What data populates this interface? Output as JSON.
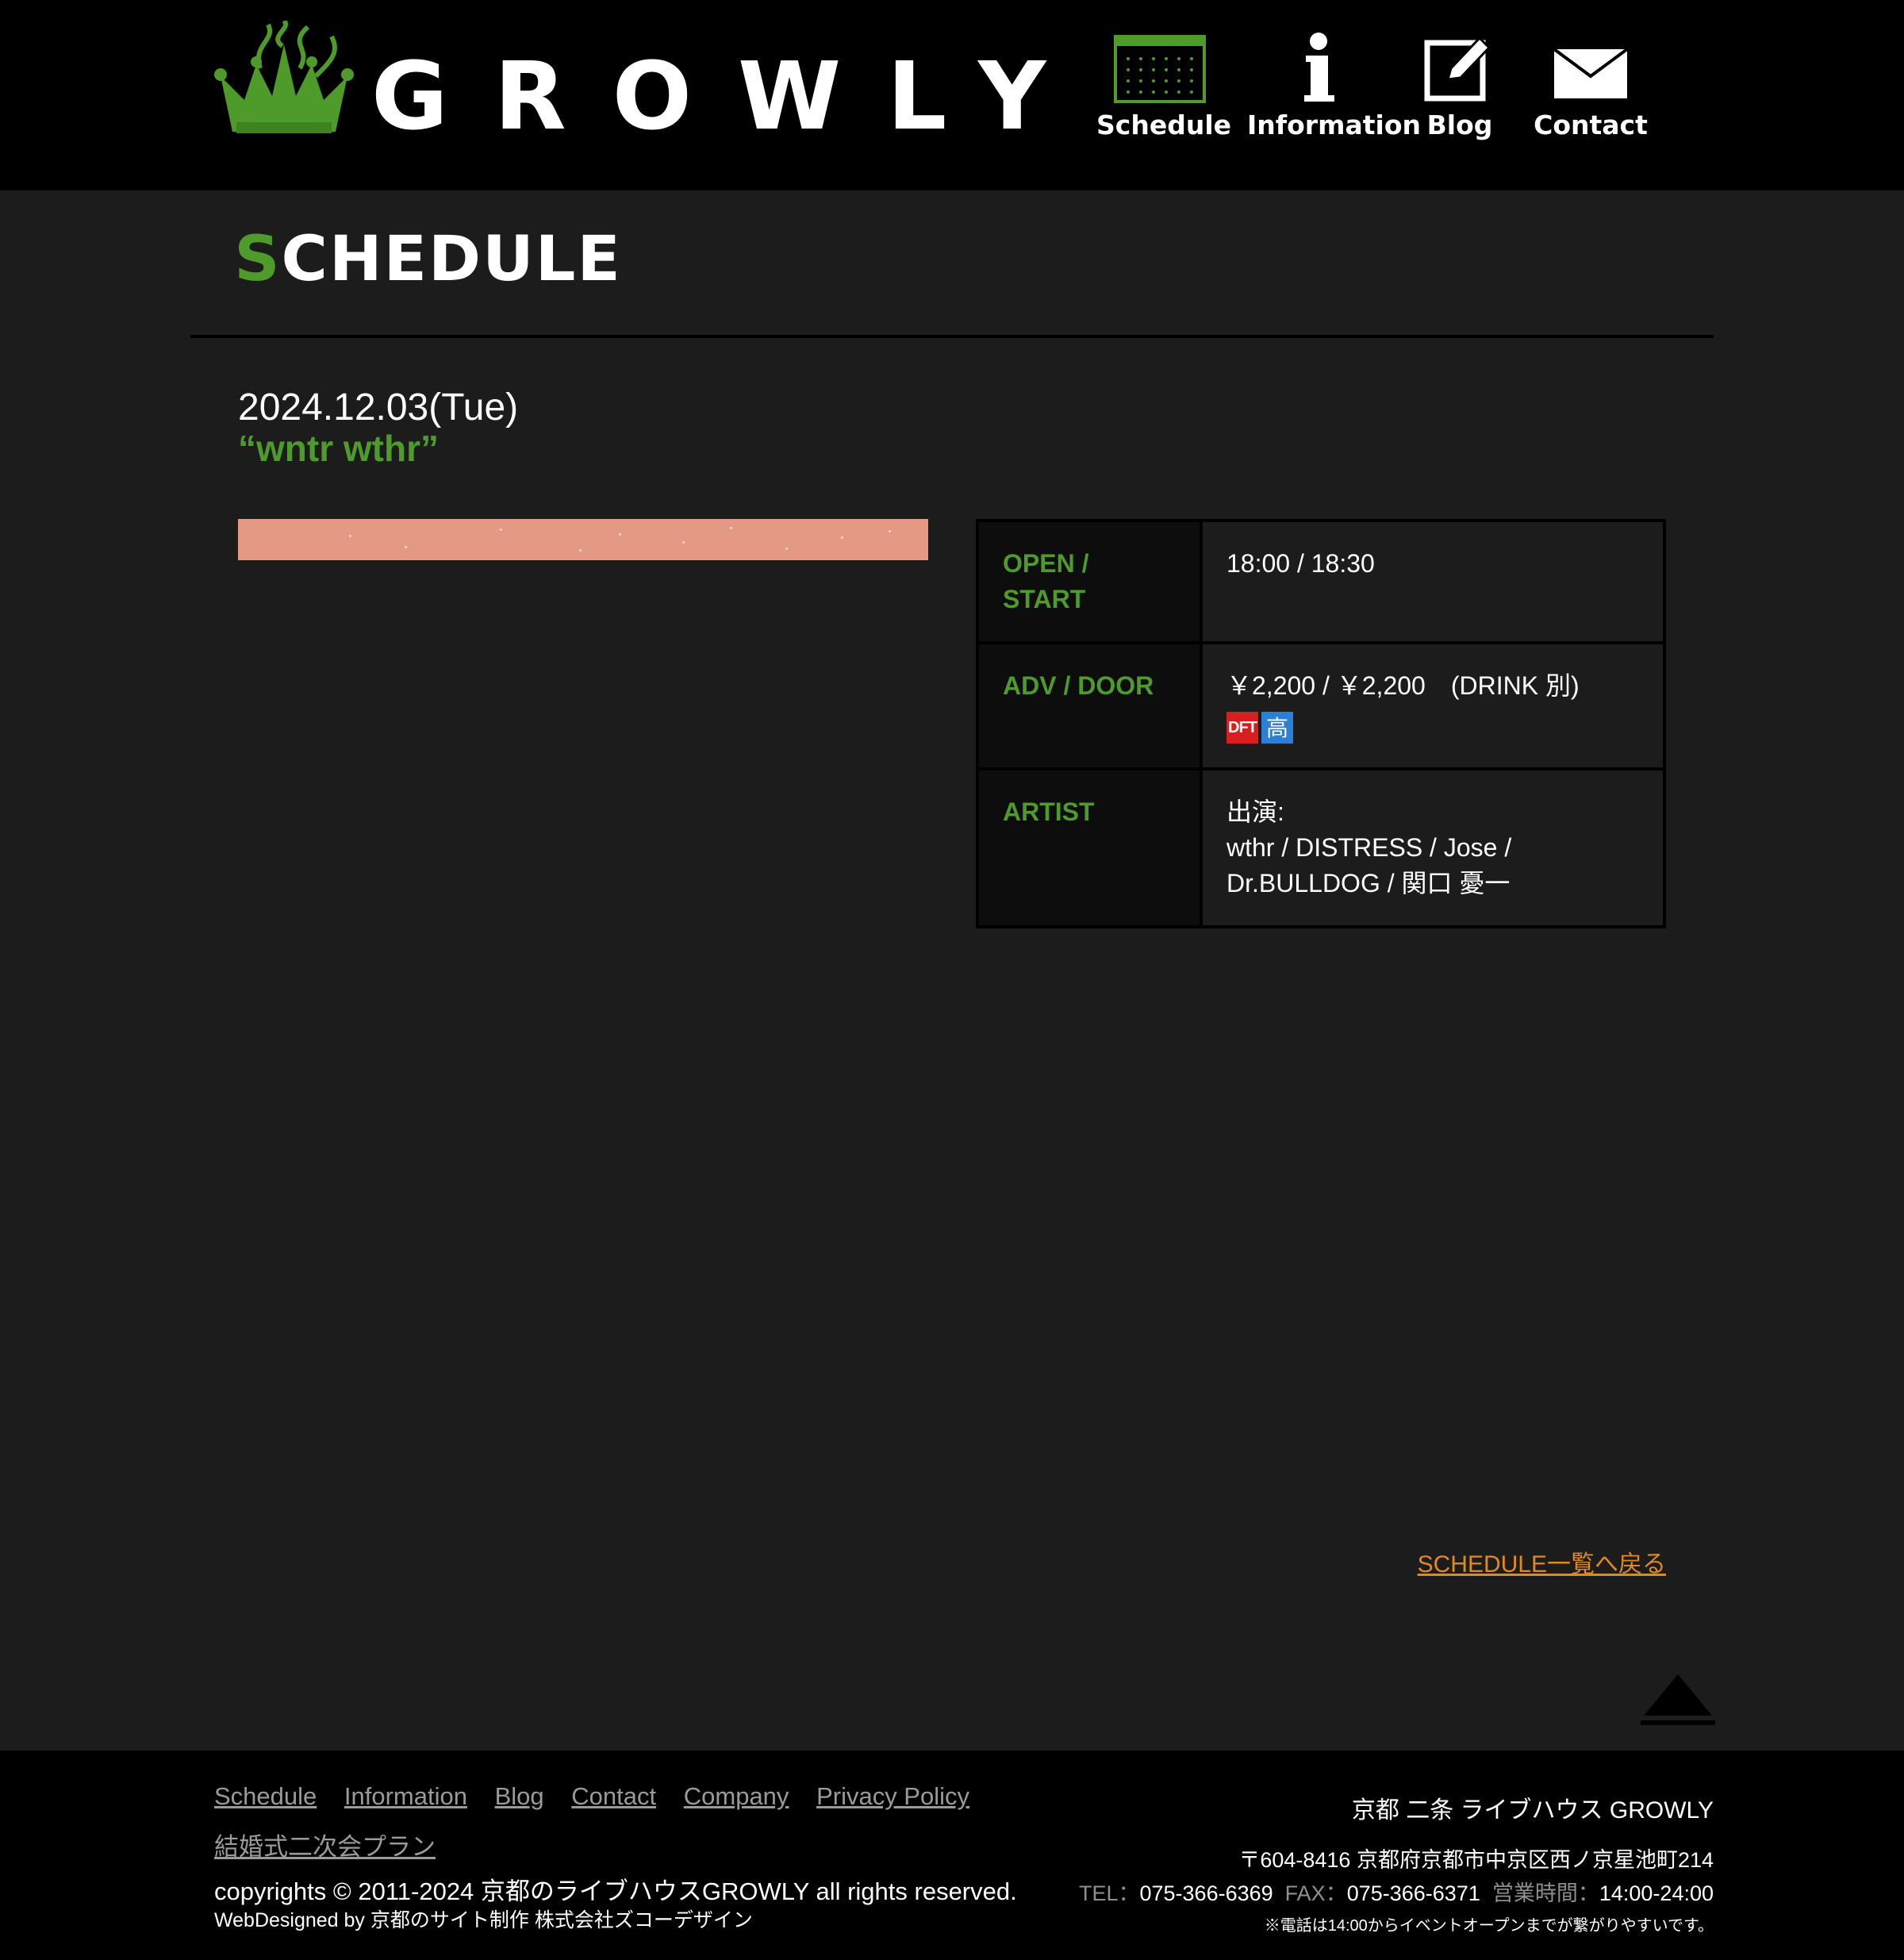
{
  "header": {
    "logo_text": "GROWLY",
    "nav": [
      {
        "label": "Schedule",
        "icon": "calendar-icon"
      },
      {
        "label": "Information",
        "icon": "info-icon"
      },
      {
        "label": "Blog",
        "icon": "pencil-icon"
      },
      {
        "label": "Contact",
        "icon": "envelope-icon"
      }
    ]
  },
  "page": {
    "heading_first": "S",
    "heading_rest": "CHEDULE"
  },
  "event": {
    "date": "2024.12.03(Tue)",
    "title": "“wntr wthr”",
    "info": {
      "open_label": "OPEN / START",
      "open_value": "18:00 / 18:30",
      "price_label": "ADV / DOOR",
      "price_value": "￥2,200 / ￥2,200　(DRINK 別)",
      "badge_dft": "DFT",
      "badge_kou": "高",
      "artist_label": "ARTIST",
      "artist_line1": "出演:",
      "artist_line2": "wthr / DISTRESS / Jose /",
      "artist_line3": "Dr.BULLDOG / 関口 憂一"
    }
  },
  "back_link": "SCHEDULE一覧へ戻る",
  "footer": {
    "links": [
      "Schedule",
      "Information",
      "Blog",
      "Contact",
      "Company",
      "Privacy Policy"
    ],
    "wedding_link": "結婚式二次会プラン",
    "copyright": "copyrights © 2011-2024 京都のライブハウスGROWLY all rights reserved.",
    "webdesigned": "WebDesigned by 京都のサイト制作 株式会社ズコーデザイン",
    "venue_name": "京都 二条 ライブハウス GROWLY",
    "address": "〒604-8416 京都府京都市中京区西ノ京星池町214",
    "tel_label": "TEL：",
    "tel": "075-366-6369",
    "fax_label": "FAX：",
    "fax": "075-366-6371",
    "hours_label": "営業時間：",
    "hours": "14:00-24:00",
    "tel_note": "※電話は14:00からイベントオープンまでが繋がりやすいです。"
  },
  "colors": {
    "accent_green": "#4e9a2a",
    "link_orange": "#e08a1e",
    "background": "#1c1c1c",
    "header_footer": "#000000"
  }
}
